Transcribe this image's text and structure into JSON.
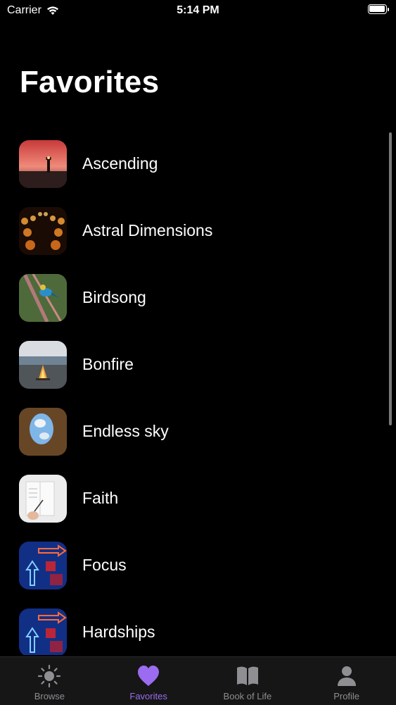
{
  "status_bar": {
    "carrier": "Carrier",
    "time": "5:14 PM"
  },
  "header": {
    "title": "Favorites"
  },
  "favorites": [
    {
      "label": "Ascending",
      "thumbnail": "lighthouse-sunset-thumbnail"
    },
    {
      "label": "Astral Dimensions",
      "thumbnail": "candles-thumbnail"
    },
    {
      "label": "Birdsong",
      "thumbnail": "bird-on-branch-thumbnail"
    },
    {
      "label": "Bonfire",
      "thumbnail": "bonfire-landscape-thumbnail"
    },
    {
      "label": "Endless sky",
      "thumbnail": "sky-through-hole-thumbnail"
    },
    {
      "label": "Faith",
      "thumbnail": "writing-notebook-thumbnail"
    },
    {
      "label": "Focus",
      "thumbnail": "neon-arrows-thumbnail"
    },
    {
      "label": "Hardships",
      "thumbnail": "neon-arrows-thumbnail"
    }
  ],
  "tab_bar": {
    "tabs": [
      {
        "label": "Browse",
        "icon": "sun-icon",
        "active": false
      },
      {
        "label": "Favorites",
        "icon": "heart-icon",
        "active": true
      },
      {
        "label": "Book of Life",
        "icon": "book-icon",
        "active": false
      },
      {
        "label": "Profile",
        "icon": "person-icon",
        "active": false
      }
    ]
  },
  "colors": {
    "accent": "#9b6cf0",
    "background": "#000000",
    "tab_inactive": "#8e8e93"
  }
}
